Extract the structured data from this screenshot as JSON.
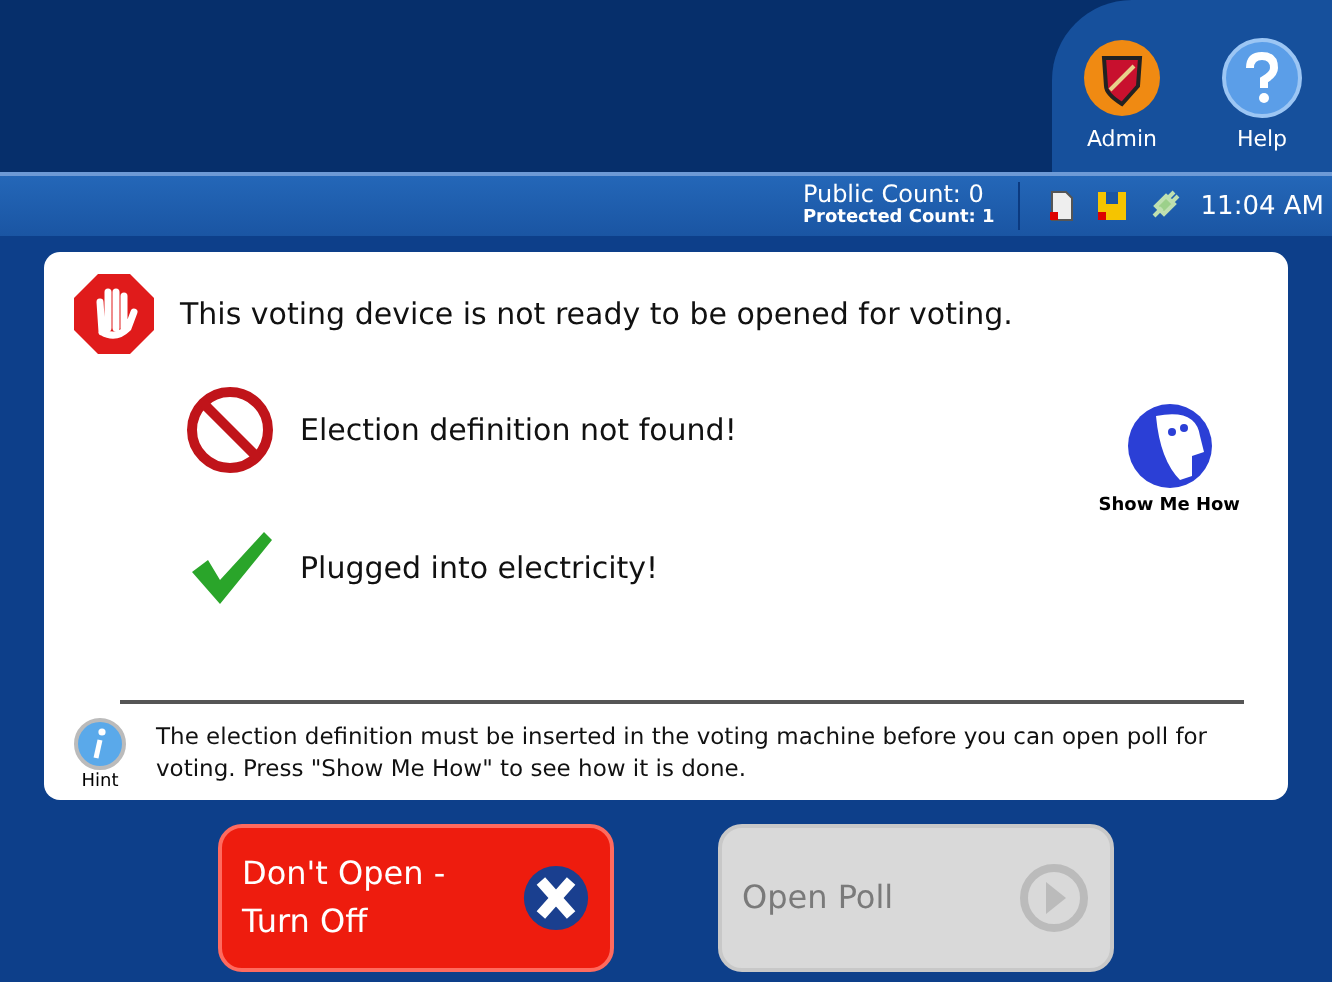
{
  "header": {
    "actions": [
      {
        "label": "Admin",
        "kind": "admin"
      },
      {
        "label": "Help",
        "kind": "help"
      }
    ]
  },
  "status_bar": {
    "public_count": "Public Count: 0",
    "protected_count": "Protected Count: 1",
    "time": "11:04 AM"
  },
  "message": {
    "title": "This voting device is not ready to be opened for voting.",
    "checks": [
      {
        "text": "Election definition not found!",
        "kind": "fail"
      },
      {
        "text": "Plugged into electricity!",
        "kind": "pass"
      }
    ],
    "show_me_how": "Show Me How",
    "hint_label": "Hint",
    "hint": "The election definition must be inserted in the voting machine before you can open poll for voting.  Press \"Show Me How\" to see how it is done."
  },
  "buttons": [
    {
      "label": "Don't Open - Turn Off",
      "kind": "cancel",
      "disabled": false
    },
    {
      "label": "Open Poll",
      "kind": "proceed",
      "disabled": true
    }
  ]
}
